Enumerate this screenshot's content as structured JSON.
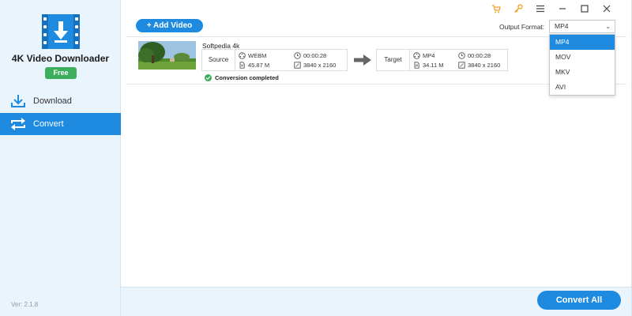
{
  "app": {
    "name": "4K Video Downloader",
    "badge": "Free",
    "version": "Ver: 2.1.8",
    "accent_color": "#1e8be0",
    "badge_color": "#3cae5c"
  },
  "sidebar": {
    "items": [
      {
        "label": "Download",
        "icon": "download-icon",
        "active": false
      },
      {
        "label": "Convert",
        "icon": "convert-icon",
        "active": true
      }
    ]
  },
  "toolbar": {
    "add_video_label": "+ Add Video",
    "window_icons": [
      "cart-icon",
      "key-icon",
      "menu-icon",
      "minimize-icon",
      "maximize-icon",
      "close-icon"
    ]
  },
  "output_format": {
    "label": "Output Format:",
    "selected": "MP4",
    "options": [
      "MP4",
      "MOV",
      "MKV",
      "AVI"
    ]
  },
  "items": [
    {
      "title": "Softpedia 4k",
      "source": {
        "label": "Source",
        "format": "WEBM",
        "duration": "00:00:28",
        "size": "45.87 M",
        "resolution": "3840 x 2160"
      },
      "target": {
        "label": "Target",
        "format": "MP4",
        "duration": "00:00:28",
        "size": "34.11 M",
        "resolution": "3840 x 2160"
      },
      "status": "Conversion completed"
    }
  ],
  "footer": {
    "convert_all_label": "Convert All"
  }
}
